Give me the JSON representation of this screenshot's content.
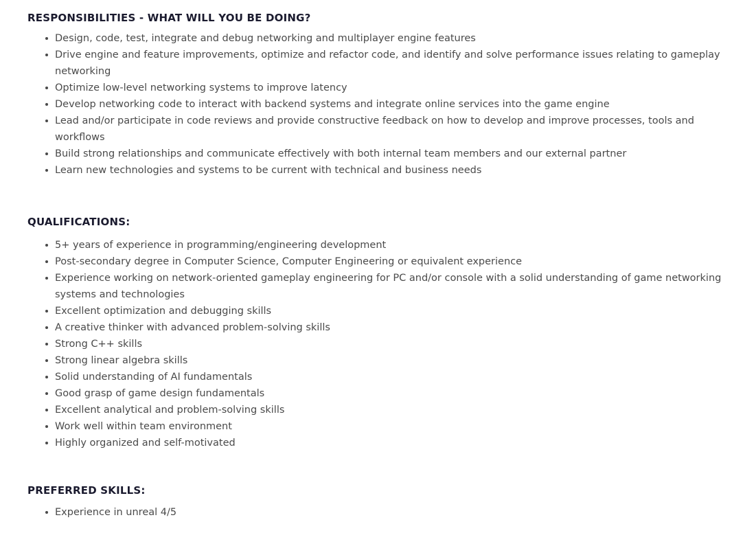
{
  "document": {
    "text_color": "#4a4a4a",
    "heading_color": "#1a1a2e",
    "highlight_color": "#ee0000",
    "background": "#ffffff"
  },
  "sections": {
    "responsibilities": {
      "heading": "RESPONSIBILITIES - WHAT WILL YOU BE DOING?",
      "items": [
        "Design, code, test, integrate and debug networking and multiplayer engine features",
        "Drive engine and feature improvements, optimize and refactor code, and identify and solve performance issues relating to gameplay networking",
        "Optimize low-level networking systems to improve latency",
        "Develop networking code to interact with backend systems and integrate online services into the game engine",
        "Lead and/or participate in code reviews and provide constructive feedback on how to develop and improve processes, tools and workflows",
        "Build strong relationships and communicate effectively with both internal team members and our external partner",
        "Learn new technologies and systems to be current with technical and business needs"
      ]
    },
    "qualifications": {
      "heading": "QUALIFICATIONS:",
      "items": [
        "5+ years of experience in programming/engineering development",
        "Post-secondary degree in Computer Science, Computer Engineering or equivalent experience",
        "Excellent optimization and debugging skills",
        "A creative thinker with advanced problem-solving skills",
        "Strong C++ skills",
        "Strong linear algebra skills",
        "Solid understanding of AI fundamentals",
        "Good grasp of game design fundamentals",
        "Excellent analytical and problem-solving skills",
        "Work well within team environment",
        "Highly organized and self-motivated"
      ],
      "highlighted_item": {
        "highlighted_text": "Experience working on network-oriented gameplay engineering for PC and/or console",
        "trailing_text": " with a solid understanding of game networking systems and technologies"
      }
    },
    "preferred_skills": {
      "heading": "PREFERRED SKILLS:",
      "highlighted_item": {
        "highlighted_text": "Experience in unreal 4/5"
      }
    }
  }
}
